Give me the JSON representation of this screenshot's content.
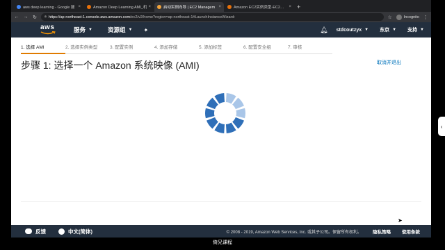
{
  "browser": {
    "tabs": [
      {
        "label": "aws deep learning - Google 搜",
        "favicon_color": "#4285f4",
        "active": false
      },
      {
        "label": "Amazon Deep Learning AMI_机",
        "favicon_color": "#e8710a",
        "active": false
      },
      {
        "label": "启动实例向导 | EC2 Managem",
        "favicon_color": "#f2a33a",
        "active": true
      },
      {
        "label": "Amazon EC2实例类型-EC2虚拟",
        "favicon_color": "#e8710a",
        "active": false
      }
    ],
    "close_glyph": "×",
    "new_tab_glyph": "+",
    "url_host": "https://ap-northeast-1.console.aws.amazon.com",
    "url_rest": "/ec2/v2/home?region=ap-northeast-1#LaunchInstanceWizard:",
    "incognito_label": "Incognito"
  },
  "aws_nav": {
    "logo_text": "aws",
    "services": "服务",
    "resource_groups": "资源组",
    "username": "stdcoutzyx",
    "region": "东京",
    "support": "支持"
  },
  "wizard": {
    "steps": [
      "1. 选择 AMI",
      "2. 选择实例类型",
      "3. 配置实例",
      "4. 添加存储",
      "5. 添加标签",
      "6. 配置安全组",
      "7. 审核"
    ],
    "active_step": 0,
    "title": "步骤 1: 选择一个 Amazon 系统映像 (AMI)",
    "cancel_label": "取消并退出"
  },
  "footer": {
    "feedback": "反馈",
    "language": "中文(简体)",
    "copyright": "© 2008 - 2019, Amazon Web Services, Inc. 或其子公司。保留所有权利。",
    "privacy": "隐私策略",
    "terms": "使用条款"
  },
  "caption": "倚兄课程",
  "colors": {
    "nav_bg": "#232f3e",
    "accent_orange": "#e07b00",
    "link_blue": "#0073bb",
    "spinner_dark": "#2f6fb8",
    "spinner_light": "#a9c6e8"
  }
}
